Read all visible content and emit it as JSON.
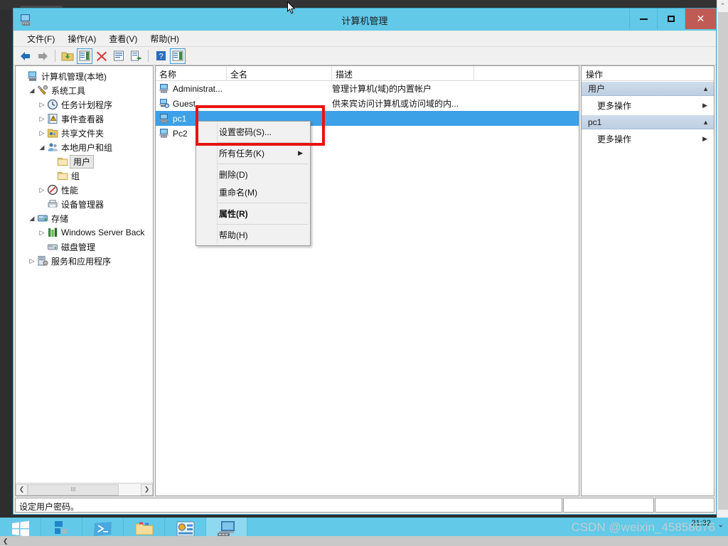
{
  "window": {
    "title": "计算机管理",
    "icon": "computer-management-icon",
    "buttons": {
      "minimize": "–",
      "maximize": "□",
      "close": "✕"
    }
  },
  "menubar": [
    {
      "label": "文件(F)",
      "name": "menu-file"
    },
    {
      "label": "操作(A)",
      "name": "menu-action"
    },
    {
      "label": "查看(V)",
      "name": "menu-view"
    },
    {
      "label": "帮助(H)",
      "name": "menu-help"
    }
  ],
  "toolbar": [
    {
      "name": "back-icon",
      "glyph": "◀"
    },
    {
      "name": "forward-icon",
      "glyph": "▶"
    },
    {
      "name": "up-folder-icon",
      "glyph": "📁"
    },
    {
      "name": "show-hide-tree-icon",
      "glyph": "▤"
    },
    {
      "name": "delete-icon",
      "glyph": "✖"
    },
    {
      "name": "properties-icon",
      "glyph": "▤"
    },
    {
      "name": "export-list-icon",
      "glyph": "▤"
    },
    {
      "name": "help-icon",
      "glyph": "?"
    },
    {
      "name": "show-action-pane-icon",
      "glyph": "▤"
    }
  ],
  "tree": [
    {
      "label": "计算机管理(本地)",
      "indent": 0,
      "twist": "",
      "icon": "computer-icon",
      "selected": false
    },
    {
      "label": "系统工具",
      "indent": 1,
      "twist": "◢",
      "icon": "system-tools-icon",
      "selected": false
    },
    {
      "label": "任务计划程序",
      "indent": 2,
      "twist": "▷",
      "icon": "task-scheduler-icon",
      "selected": false
    },
    {
      "label": "事件查看器",
      "indent": 2,
      "twist": "▷",
      "icon": "event-viewer-icon",
      "selected": false
    },
    {
      "label": "共享文件夹",
      "indent": 2,
      "twist": "▷",
      "icon": "shared-folders-icon",
      "selected": false
    },
    {
      "label": "本地用户和组",
      "indent": 2,
      "twist": "◢",
      "icon": "local-users-icon",
      "selected": false
    },
    {
      "label": "用户",
      "indent": 3,
      "twist": "",
      "icon": "folder-icon",
      "selected": true
    },
    {
      "label": "组",
      "indent": 3,
      "twist": "",
      "icon": "folder-icon",
      "selected": false
    },
    {
      "label": "性能",
      "indent": 2,
      "twist": "▷",
      "icon": "performance-icon",
      "selected": false
    },
    {
      "label": "设备管理器",
      "indent": 2,
      "twist": "",
      "icon": "device-manager-icon",
      "selected": false
    },
    {
      "label": "存储",
      "indent": 1,
      "twist": "◢",
      "icon": "storage-icon",
      "selected": false
    },
    {
      "label": "Windows Server Back",
      "indent": 2,
      "twist": "▷",
      "icon": "backup-icon",
      "selected": false
    },
    {
      "label": "磁盘管理",
      "indent": 2,
      "twist": "",
      "icon": "disk-management-icon",
      "selected": false
    },
    {
      "label": "服务和应用程序",
      "indent": 1,
      "twist": "▷",
      "icon": "services-icon",
      "selected": false
    }
  ],
  "list": {
    "columns": [
      "名称",
      "全名",
      "描述",
      ""
    ],
    "rows": [
      {
        "name": "Administrat...",
        "fullname": "",
        "description": "管理计算机(域)的内置帐户",
        "icon": "user-icon",
        "selected": false
      },
      {
        "name": "Guest",
        "fullname": "",
        "description": "供来宾访问计算机或访问域的内...",
        "icon": "user-disabled-icon",
        "selected": false
      },
      {
        "name": "pc1",
        "fullname": "",
        "description": "",
        "icon": "user-icon",
        "selected": true
      },
      {
        "name": "Pc2",
        "fullname": "",
        "description": "",
        "icon": "user-icon",
        "selected": false
      }
    ]
  },
  "context_menu": {
    "items": [
      {
        "label": "设置密码(S)...",
        "bold": false,
        "submenu": false,
        "separator_after": true
      },
      {
        "label": "所有任务(K)",
        "bold": false,
        "submenu": true,
        "separator_after": true
      },
      {
        "label": "删除(D)",
        "bold": false,
        "submenu": false,
        "separator_after": false
      },
      {
        "label": "重命名(M)",
        "bold": false,
        "submenu": false,
        "separator_after": true
      },
      {
        "label": "属性(R)",
        "bold": true,
        "submenu": false,
        "separator_after": true
      },
      {
        "label": "帮助(H)",
        "bold": false,
        "submenu": false,
        "separator_after": false
      }
    ],
    "submenu_arrow": "▶"
  },
  "actions": {
    "header": "操作",
    "groups": [
      {
        "title": "用户",
        "caret": "▲",
        "items": [
          {
            "label": "更多操作",
            "arrow": "▶"
          }
        ]
      },
      {
        "title": "pc1",
        "caret": "▲",
        "items": [
          {
            "label": "更多操作",
            "arrow": "▶"
          }
        ]
      }
    ]
  },
  "statusbar": {
    "text": "设定用户密码。",
    "cell2": "",
    "cell3": ""
  },
  "treescroll": {
    "left_arrow": "❮",
    "right_arrow": "❯",
    "thumb_grip": "ااا"
  },
  "taskbar": {
    "items": [
      {
        "name": "start-button-icon",
        "active": false
      },
      {
        "name": "server-manager-icon",
        "active": false
      },
      {
        "name": "powershell-icon",
        "active": false
      },
      {
        "name": "file-explorer-icon",
        "active": false
      },
      {
        "name": "control-panel-icon",
        "active": false
      },
      {
        "name": "computer-management-icon",
        "active": true
      }
    ],
    "clock": "21:32",
    "tray_caret": "⌄",
    "watermark": "CSDN @weixin_45858676",
    "strip_arrow": "❮"
  },
  "colors": {
    "accent": "#62c9e8",
    "selection": "#3da1e8",
    "annotation": "#e81313",
    "close_button": "#bf5b54",
    "action_group": "#c6d6e6"
  }
}
